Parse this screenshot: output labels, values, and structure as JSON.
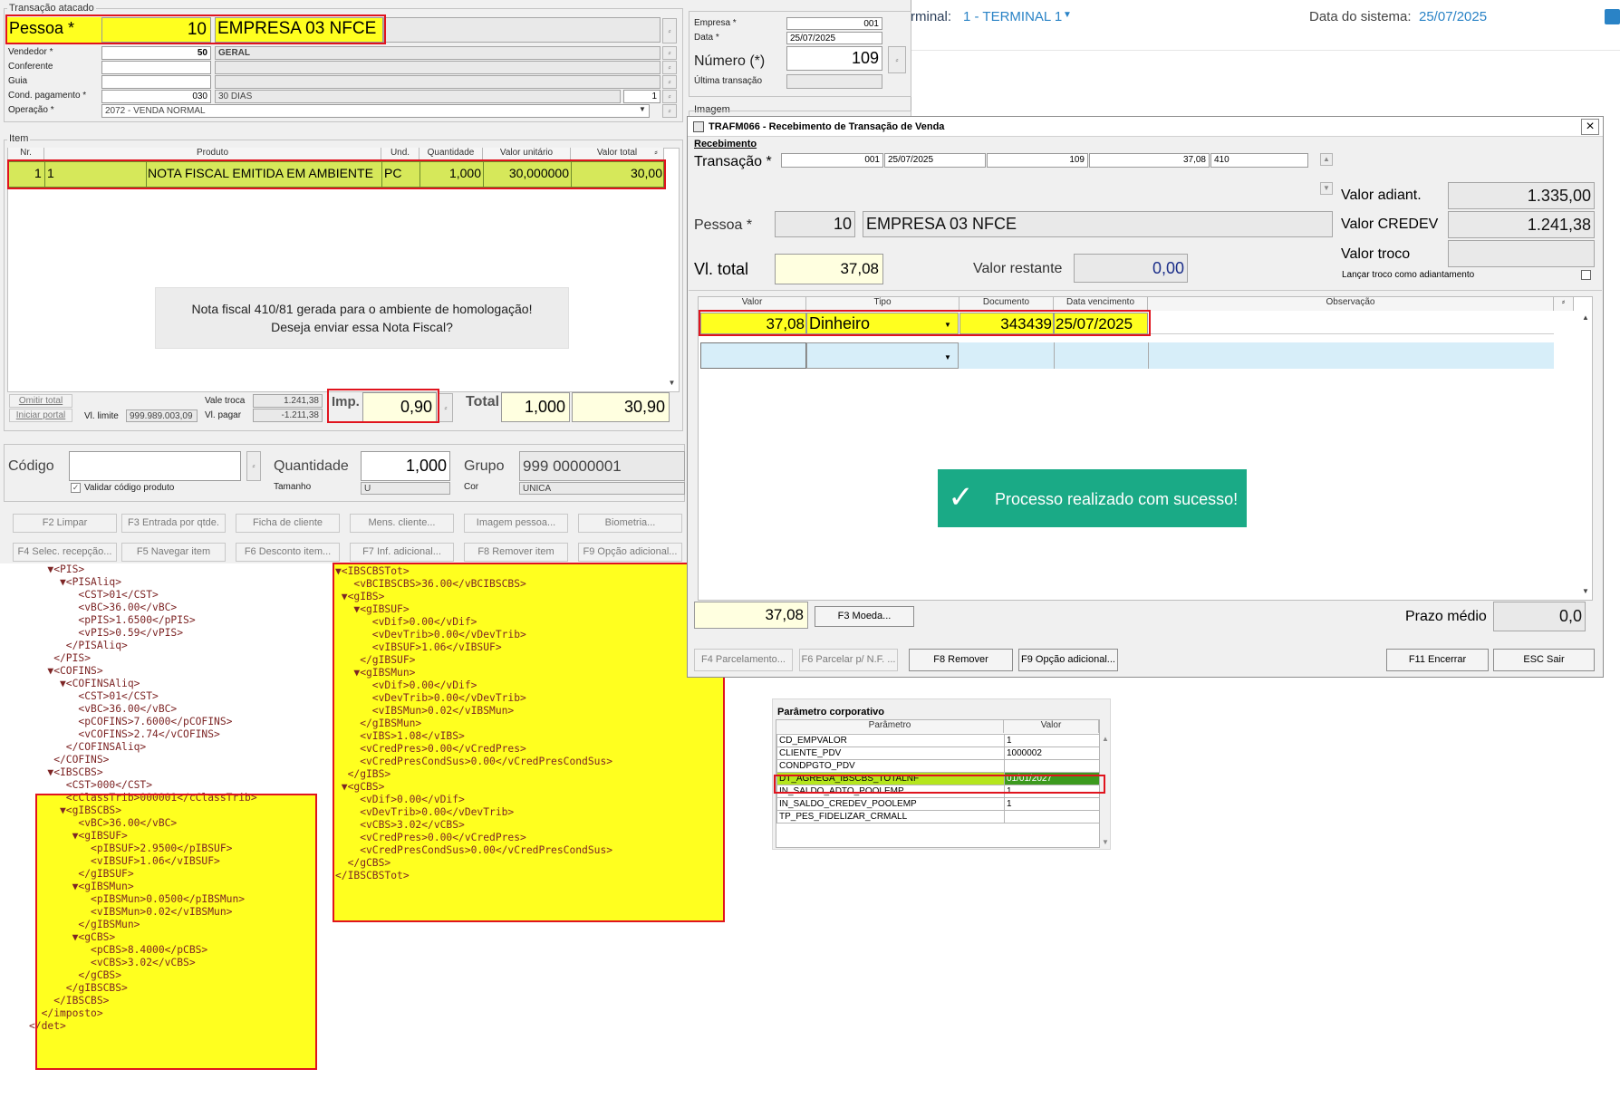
{
  "topbar": {
    "terminal_prefix": "rminal:",
    "terminal_value": "1 - TERMINAL 1",
    "system_date_label": "Data do sistema:",
    "system_date_value": "25/07/2025"
  },
  "trans": {
    "group_title": "Transação atacado",
    "pessoa_label": "Pessoa *",
    "pessoa_code": "10",
    "pessoa_name": "EMPRESA 03 NFCE",
    "vendedor_label": "Vendedor *",
    "vendedor_code": "50",
    "vendedor_name": "GERAL",
    "conferente_label": "Conferente",
    "guia_label": "Guia",
    "cond_label": "Cond. pagamento *",
    "cond_code": "030",
    "cond_name": "30 DIAS",
    "cond_extra": "1",
    "operacao_label": "Operação *",
    "operacao_value": "2072 - VENDA NORMAL",
    "empresa_label": "Empresa *",
    "empresa_value": "001",
    "data_label": "Data *",
    "data_value": "25/07/2025",
    "numero_label": "Número (*)",
    "numero_value": "109",
    "ultima_label": "Última transação",
    "imagem_label": "Imagem"
  },
  "items": {
    "group_title": "Item",
    "headers": [
      "Nr.",
      "Produto",
      "Und.",
      "Quantidade",
      "Valor unitário",
      "Valor total"
    ],
    "row": {
      "nr": "1",
      "produto_code": "1",
      "produto": "NOTA FISCAL EMITIDA EM AMBIENTE",
      "und": "PC",
      "qtd": "1,000",
      "unit": "30,000000",
      "total": "30,00"
    },
    "dialog_line1": "Nota fiscal 410/81 gerada para o ambiente de homologação!",
    "dialog_line2": "Deseja enviar essa Nota Fiscal?"
  },
  "footer": {
    "omitir": "Omitir total",
    "iniciar": "Iniciar portal",
    "vl_limite_label": "Vl. limite",
    "vl_limite_value": "999.989.003,09",
    "vale_troca_label": "Vale troca",
    "vale_troca_value": "1.241,38",
    "vl_pagar_label": "Vl. pagar",
    "vl_pagar_value": "-1.211,38",
    "imp_label": "Imp.",
    "imp_value": "0,90",
    "total_label": "Total",
    "total_qty": "1,000",
    "total_value": "30,90"
  },
  "prod": {
    "codigo_label": "Código",
    "validar": "Validar código produto",
    "qtd_label": "Quantidade",
    "qtd_value": "1,000",
    "tamanho_label": "Tamanho",
    "tamanho_value": "U",
    "grupo_label": "Grupo",
    "grupo_value": "999 00000001",
    "cor_label": "Cor",
    "cor_value": "UNICA"
  },
  "fbuttons_row1": [
    "F2 Limpar",
    "F3 Entrada por qtde.",
    "Ficha de cliente",
    "Mens. cliente...",
    "Imagem pessoa...",
    "Biometria..."
  ],
  "fbuttons_row2": [
    "F4 Selec. recepção...",
    "F5 Navegar item",
    "F6 Desconto item...",
    "F7 Inf. adicional...",
    "F8 Remover item",
    "F9 Opção adicional..."
  ],
  "dialog": {
    "title": "TRAFM066 - Recebimento de Transação de Venda",
    "close": "×",
    "group_title": "Recebimento",
    "transacao_label": "Transação *",
    "trans_empresa": "001",
    "trans_data": "25/07/2025",
    "trans_num": "109",
    "trans_valor": "37,08",
    "trans_nf": "410",
    "pessoa_label": "Pessoa *",
    "pessoa_code": "10",
    "pessoa_name": "EMPRESA 03 NFCE",
    "vltotal_label": "Vl. total",
    "vltotal_value": "37,08",
    "restante_label": "Valor restante",
    "restante_value": "0,00",
    "adiant_label": "Valor adiant.",
    "adiant_value": "1.335,00",
    "credev_label": "Valor CREDEV",
    "credev_value": "1.241,38",
    "troco_label": "Valor troco",
    "lancar_troco": "Lançar troco como adiantamento",
    "grid_headers": [
      "Valor",
      "Tipo",
      "Documento",
      "Data vencimento",
      "Observação"
    ],
    "grid_row": {
      "valor": "37,08",
      "tipo": "Dinheiro",
      "documento": "343439",
      "vencimento": "25/07/2025",
      "obs": ""
    },
    "toast": "Processo realizado com sucesso!",
    "sum_value": "37,08",
    "moeda_btn": "F3 Moeda...",
    "prazo_label": "Prazo médio",
    "prazo_value": "0,0",
    "buttons": [
      "F4 Parcelamento...",
      "F6 Parcelar p/ N.F. ...",
      "F8 Remover",
      "F9 Opção adicional...",
      "F11 Encerrar",
      "ESC Sair"
    ]
  },
  "param": {
    "title": "Parâmetro corporativo",
    "headers": [
      "Parâmetro",
      "Valor"
    ],
    "rows": [
      [
        "CD_EMPVALOR",
        "1"
      ],
      [
        "CLIENTE_PDV",
        "1000002"
      ],
      [
        "CONDPGTO_PDV",
        ""
      ],
      [
        "DT_AGREGA_IBSCBS_TOTALNF",
        "01/01/2027"
      ],
      [
        "IN_SALDO_ADTO_POOLEMP",
        "1"
      ],
      [
        "IN_SALDO_CREDEV_POOLEMP",
        "1"
      ],
      [
        "TP_PES_FIDELIZAR_CRMALL",
        ""
      ]
    ]
  },
  "xml_left": [
    "   ▼<PIS>",
    "     ▼<PISAliq>",
    "        <CST>01</CST>",
    "        <vBC>36.00</vBC>",
    "        <pPIS>1.6500</pPIS>",
    "        <vPIS>0.59</vPIS>",
    "      </PISAliq>",
    "    </PIS>",
    "   ▼<COFINS>",
    "     ▼<COFINSAliq>",
    "        <CST>01</CST>",
    "        <vBC>36.00</vBC>",
    "        <pCOFINS>7.6000</pCOFINS>",
    "        <vCOFINS>2.74</vCOFINS>",
    "      </COFINSAliq>",
    "    </COFINS>",
    "   ▼<IBSCBS>",
    "      <CST>000</CST>",
    "      <cClassTrib>000001</cClassTrib>",
    "     ▼<gIBSCBS>",
    "        <vBC>36.00</vBC>",
    "       ▼<gIBSUF>",
    "          <pIBSUF>2.9500</pIBSUF>",
    "          <vIBSUF>1.06</vIBSUF>",
    "        </gIBSUF>",
    "       ▼<gIBSMun>",
    "          <pIBSMun>0.0500</pIBSMun>",
    "          <vIBSMun>0.02</vIBSMun>",
    "        </gIBSMun>",
    "       ▼<gCBS>",
    "          <pCBS>8.4000</pCBS>",
    "          <vCBS>3.02</vCBS>",
    "        </gCBS>",
    "      </gIBSCBS>",
    "    </IBSCBS>",
    "  </imposto>",
    "</det>"
  ],
  "xml_right": [
    "▼<IBSCBSTot>",
    "   <vBCIBSCBS>36.00</vBCIBSCBS>",
    " ▼<gIBS>",
    "   ▼<gIBSUF>",
    "      <vDif>0.00</vDif>",
    "      <vDevTrib>0.00</vDevTrib>",
    "      <vIBSUF>1.06</vIBSUF>",
    "    </gIBSUF>",
    "   ▼<gIBSMun>",
    "      <vDif>0.00</vDif>",
    "      <vDevTrib>0.00</vDevTrib>",
    "      <vIBSMun>0.02</vIBSMun>",
    "    </gIBSMun>",
    "    <vIBS>1.08</vIBS>",
    "    <vCredPres>0.00</vCredPres>",
    "    <vCredPresCondSus>0.00</vCredPresCondSus>",
    "  </gIBS>",
    " ▼<gCBS>",
    "    <vDif>0.00</vDif>",
    "    <vDevTrib>0.00</vDevTrib>",
    "    <vCBS>3.02</vCBS>",
    "    <vCredPres>0.00</vCredPres>",
    "    <vCredPresCondSus>0.00</vCredPresCondSus>",
    "  </gCBS>",
    "</IBSCBSTot>"
  ]
}
